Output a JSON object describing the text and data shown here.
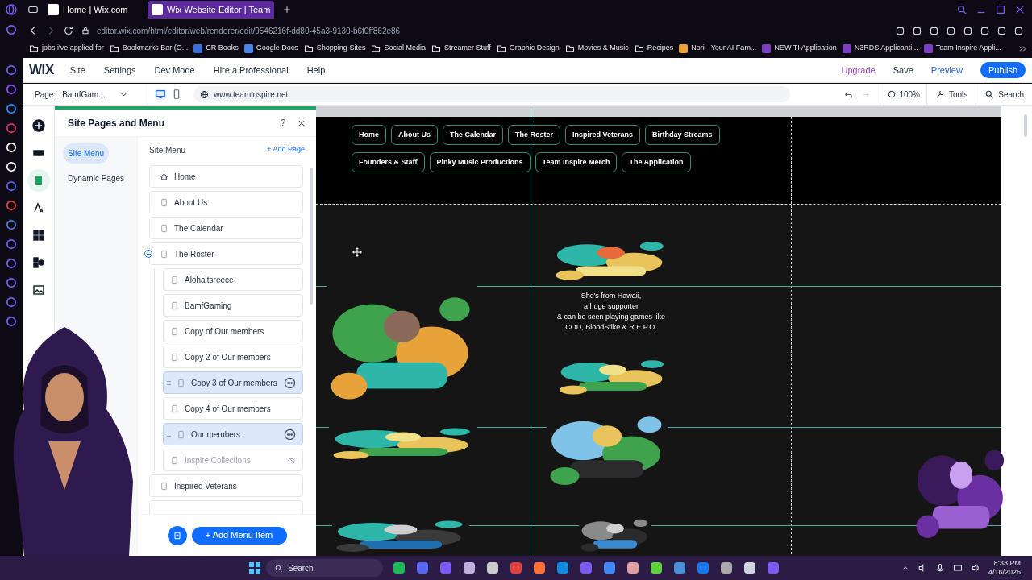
{
  "browser": {
    "tabs": [
      {
        "title": "Home | Wix.com",
        "selected": false
      },
      {
        "title": "Wix Website Editor | Team",
        "selected": true
      }
    ],
    "url": "editor.wix.com/html/editor/web/renderer/edit/9546216f-dd80-45a3-9130-b6f0ff862e86",
    "bookmarks": [
      {
        "label": "jobs i've applied for",
        "kind": "folder"
      },
      {
        "label": "Bookmarks Bar (O...",
        "kind": "folder"
      },
      {
        "label": "CR Books",
        "kind": "link",
        "color": "#3b6fd8"
      },
      {
        "label": "Google Docs",
        "kind": "link",
        "color": "#4a86e8"
      },
      {
        "label": "Shopping Sites",
        "kind": "folder"
      },
      {
        "label": "Social Media",
        "kind": "folder"
      },
      {
        "label": "Streamer Stuff",
        "kind": "folder"
      },
      {
        "label": "Graphic Design",
        "kind": "folder"
      },
      {
        "label": "Movies & Music",
        "kind": "folder"
      },
      {
        "label": "Recipes",
        "kind": "folder"
      },
      {
        "label": "Nori - Your AI Fam...",
        "kind": "link",
        "color": "#e8a23a"
      },
      {
        "label": "NEW TI Application",
        "kind": "link",
        "color": "#7b3fc4"
      },
      {
        "label": "N3RDS Applicanti...",
        "kind": "link",
        "color": "#7b3fc4"
      },
      {
        "label": "Team Inspire Appli...",
        "kind": "link",
        "color": "#7b3fc4"
      }
    ]
  },
  "editor": {
    "logo": "WIX",
    "menu": [
      "Site",
      "Settings",
      "Dev Mode",
      "Hire a Professional",
      "Help"
    ],
    "upgrade": "Upgrade",
    "save": "Save",
    "preview": "Preview",
    "publish": "Publish",
    "page_label": "Page:",
    "page_value": "BamfGam...",
    "site_url": "www.teaminspire.net",
    "zoom": "100%",
    "tools": "Tools",
    "search": "Search"
  },
  "panel": {
    "title": "Site Pages and Menu",
    "help": "?",
    "tabs": [
      {
        "label": "Site Menu",
        "selected": true
      },
      {
        "label": "Dynamic Pages",
        "selected": false
      }
    ],
    "heading": "Site Menu",
    "add_page": "+ Add Page",
    "pages": [
      {
        "label": "Home",
        "kind": "home",
        "selected": false,
        "hidden": false
      },
      {
        "label": "About Us",
        "kind": "page",
        "selected": false,
        "hidden": false
      },
      {
        "label": "The Calendar",
        "kind": "page",
        "selected": false,
        "hidden": false
      },
      {
        "label": "The Roster",
        "kind": "page",
        "selected": false,
        "hidden": false,
        "expanded": true,
        "children": [
          {
            "label": "Alohaitsreece",
            "kind": "page",
            "selected": false,
            "hidden": false
          },
          {
            "label": "BamfGaming",
            "kind": "page",
            "selected": false,
            "hidden": false
          },
          {
            "label": "Copy of Our members",
            "kind": "page",
            "selected": false,
            "hidden": false
          },
          {
            "label": "Copy 2 of Our members",
            "kind": "page",
            "selected": false,
            "hidden": false
          },
          {
            "label": "Copy 3 of Our members",
            "kind": "page",
            "selected": true,
            "hidden": false
          },
          {
            "label": "Copy 4 of Our members",
            "kind": "page",
            "selected": false,
            "hidden": false
          },
          {
            "label": "Our members",
            "kind": "page",
            "selected": true,
            "hidden": false
          },
          {
            "label": "Inspire Collections",
            "kind": "page",
            "selected": false,
            "hidden": true
          }
        ]
      },
      {
        "label": "Inspired Veterans",
        "kind": "page",
        "selected": false,
        "hidden": false
      }
    ],
    "add_menu_item": "+ Add Menu Item"
  },
  "canvas": {
    "nav_rows": [
      [
        "Home",
        "About Us",
        "The Calendar",
        "The Roster",
        "Inspired Veterans",
        "Birthday Streams"
      ],
      [
        "Founders & Staff",
        "Pinky Music Productions",
        "Team Inspire Merch",
        "The Application"
      ]
    ],
    "about_lines": [
      "She's from Hawaii,",
      "a huge supporter",
      "& can be seen playing games like",
      "COD, BloodStike & R.E.P.O."
    ]
  },
  "taskbar": {
    "search": "Search",
    "time": "8:33 PM",
    "date": "4/16/2026"
  }
}
